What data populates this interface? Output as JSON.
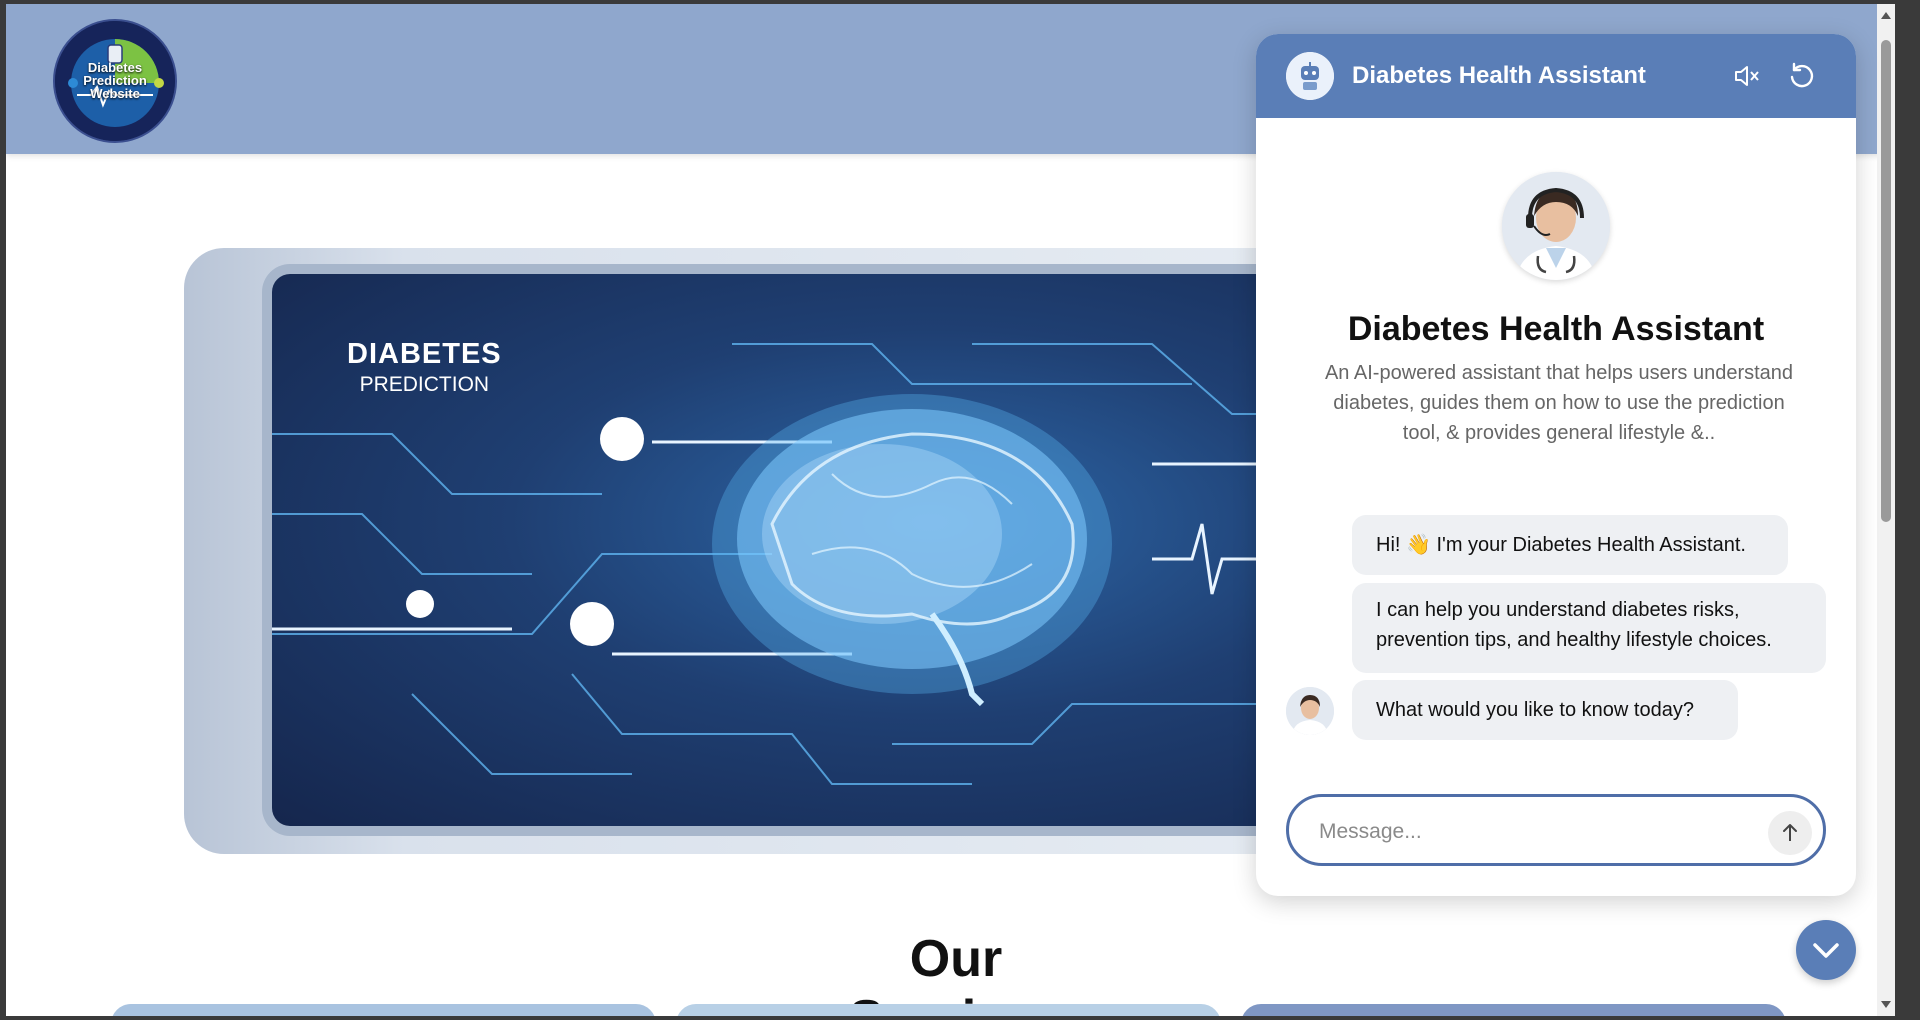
{
  "site": {
    "logo_line1": "Diabetes",
    "logo_line2": "Prediction",
    "logo_line3": "Website"
  },
  "hero": {
    "title_line1": "DIABETES",
    "title_line2": "PREDICTION"
  },
  "services": {
    "heading": "Our Services"
  },
  "chat": {
    "header_title": "Diabetes Health Assistant",
    "intro_title": "Diabetes Health Assistant",
    "intro_description": "An AI-powered assistant that helps users understand diabetes, guides them on how to use the prediction tool, & provides general lifestyle &..",
    "messages": [
      "Hi! 👋 I'm your Diabetes Health Assistant.",
      "I can help you understand diabetes risks, prevention tips, and healthy lifestyle choices.",
      "What would you like to know today?"
    ],
    "input_placeholder": "Message...",
    "icons": {
      "mute": "volume-mute-icon",
      "reset": "refresh-icon",
      "send": "arrow-up-icon",
      "collapse": "chevron-down-icon"
    },
    "accent_color": "#5a7eb7"
  }
}
